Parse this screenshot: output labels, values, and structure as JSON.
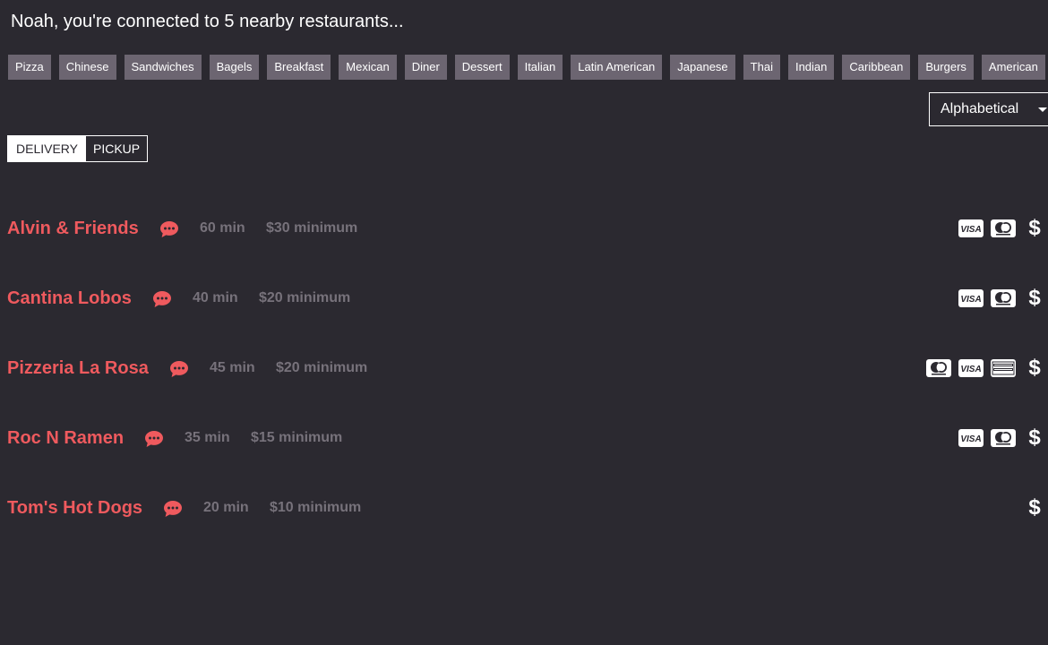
{
  "greeting": "Noah, you're connected to 5 nearby restaurants...",
  "categories": [
    "Pizza",
    "Chinese",
    "Sandwiches",
    "Bagels",
    "Breakfast",
    "Mexican",
    "Diner",
    "Dessert",
    "Italian",
    "Latin American",
    "Japanese",
    "Thai",
    "Indian",
    "Caribbean",
    "Burgers",
    "American"
  ],
  "sort": {
    "label": "Alphabetical"
  },
  "mode_toggle": {
    "delivery": "DELIVERY",
    "pickup": "PICKUP",
    "selected": "DELIVERY"
  },
  "colors": {
    "background": "#2b2930",
    "accent": "#ef5a5e",
    "muted": "#77727b",
    "chip": "#6c6571"
  },
  "restaurants": [
    {
      "name": "Alvin & Friends",
      "time": "60 min",
      "minimum": "$30 minimum",
      "payments": [
        "visa-icon",
        "mastercard-icon",
        "dollar-icon"
      ]
    },
    {
      "name": "Cantina Lobos",
      "time": "40 min",
      "minimum": "$20 minimum",
      "payments": [
        "visa-icon",
        "mastercard-icon",
        "dollar-icon"
      ]
    },
    {
      "name": "Pizzeria La Rosa",
      "time": "45 min",
      "minimum": "$20 minimum",
      "payments": [
        "mastercard-icon",
        "visa-icon",
        "amex-icon",
        "dollar-icon"
      ]
    },
    {
      "name": "Roc N Ramen",
      "time": "35 min",
      "minimum": "$15 minimum",
      "payments": [
        "visa-icon",
        "mastercard-icon",
        "dollar-icon"
      ]
    },
    {
      "name": "Tom's Hot Dogs",
      "time": "20 min",
      "minimum": "$10 minimum",
      "payments": [
        "dollar-icon"
      ]
    }
  ]
}
